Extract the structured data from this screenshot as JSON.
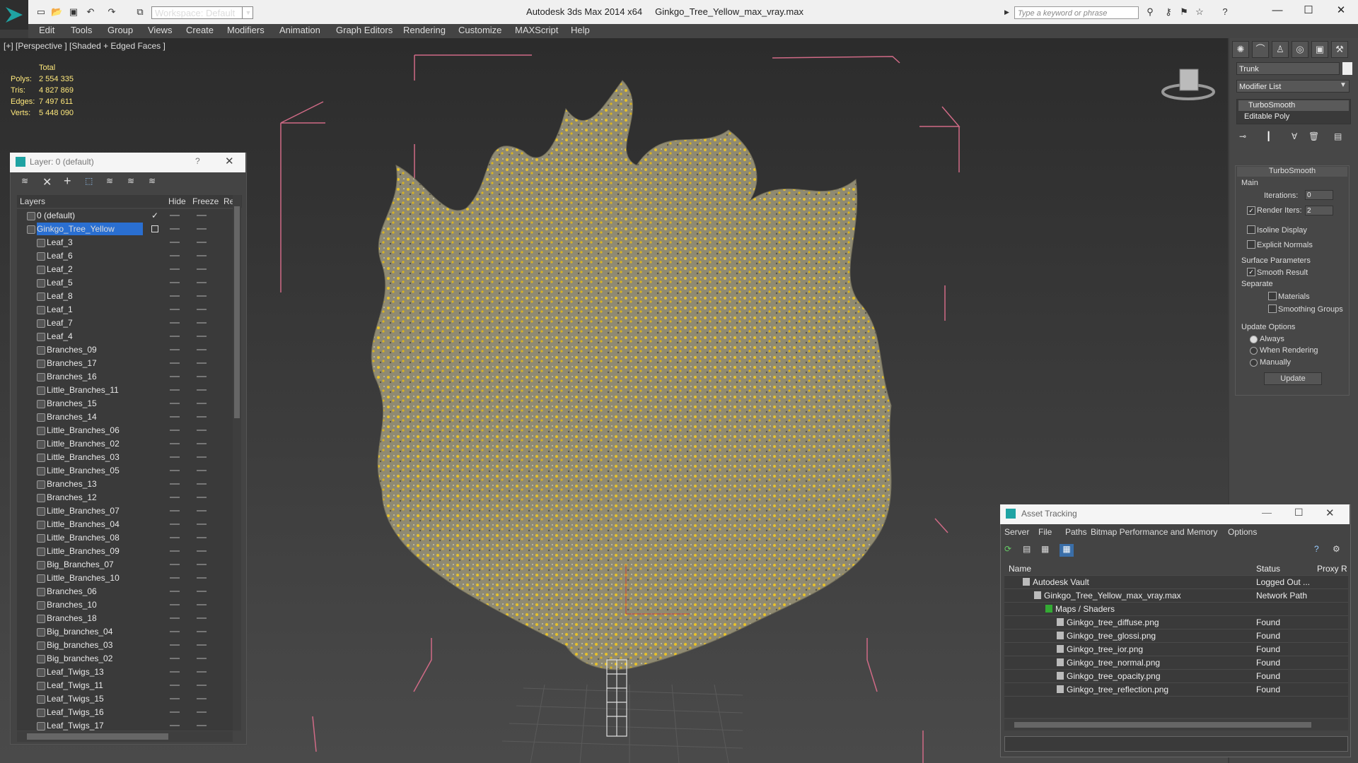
{
  "app": {
    "title": "Autodesk 3ds Max  2014 x64",
    "file": "Ginkgo_Tree_Yellow_max_vray.max",
    "workspace": "Workspace: Default",
    "search_placeholder": "Type a keyword or phrase"
  },
  "menu": [
    "Edit",
    "Tools",
    "Group",
    "Views",
    "Create",
    "Modifiers",
    "Animation",
    "Graph Editors",
    "Rendering",
    "Customize",
    "MAXScript",
    "Help"
  ],
  "viewport": {
    "label": "[+] [Perspective ] [Shaded + Edged Faces ]",
    "stats": {
      "header": "Total",
      "rows": [
        {
          "label": "Polys:",
          "value": "2 554 335"
        },
        {
          "label": "Tris:",
          "value": "4 827 869"
        },
        {
          "label": "Edges:",
          "value": "7 497 611"
        },
        {
          "label": "Verts:",
          "value": "5 448 090"
        }
      ]
    }
  },
  "layer_panel": {
    "title": "Layer: 0 (default)",
    "help": "?",
    "columns": {
      "layers": "Layers",
      "hide": "Hide",
      "freeze": "Freeze",
      "render": "Re"
    },
    "rows": [
      "0 (default)",
      "Ginkgo_Tree_Yellow",
      "Leaf_3",
      "Leaf_6",
      "Leaf_2",
      "Leaf_5",
      "Leaf_8",
      "Leaf_1",
      "Leaf_7",
      "Leaf_4",
      "Branches_09",
      "Branches_17",
      "Branches_16",
      "Little_Branches_11",
      "Branches_15",
      "Branches_14",
      "Little_Branches_06",
      "Little_Branches_02",
      "Little_Branches_03",
      "Little_Branches_05",
      "Branches_13",
      "Branches_12",
      "Little_Branches_07",
      "Little_Branches_04",
      "Little_Branches_08",
      "Little_Branches_09",
      "Big_Branches_07",
      "Little_Branches_10",
      "Branches_06",
      "Branches_10",
      "Branches_18",
      "Big_branches_04",
      "Big_branches_03",
      "Big_branches_02",
      "Leaf_Twigs_13",
      "Leaf_Twigs_11",
      "Leaf_Twigs_15",
      "Leaf_Twigs_16",
      "Leaf_Twigs_17"
    ]
  },
  "command_panel": {
    "object_name": "Trunk",
    "modifier_list": "Modifier List",
    "stack": [
      "TurboSmooth",
      "Editable Poly"
    ],
    "turbosmooth": {
      "title": "TurboSmooth",
      "main": "Main",
      "iterations_label": "Iterations:",
      "iterations": "0",
      "render_iters_label": "Render Iters:",
      "render_iters": "2",
      "isoline": "Isoline Display",
      "explicit": "Explicit Normals",
      "surface_params": "Surface Parameters",
      "smooth_result": "Smooth Result",
      "separate": "Separate",
      "materials": "Materials",
      "smoothing_groups": "Smoothing Groups",
      "update_options": "Update Options",
      "always": "Always",
      "when_rendering": "When Rendering",
      "manually": "Manually",
      "update": "Update"
    }
  },
  "asset_tracking": {
    "title": "Asset Tracking",
    "menu": [
      "Server",
      "File",
      "Paths",
      "Bitmap Performance and Memory",
      "Options"
    ],
    "columns": {
      "name": "Name",
      "status": "Status",
      "proxy": "Proxy R"
    },
    "rows": [
      {
        "name": "Autodesk Vault",
        "status": "Logged Out ...",
        "indent": 0
      },
      {
        "name": "Ginkgo_Tree_Yellow_max_vray.max",
        "status": "Network Path",
        "indent": 1
      },
      {
        "name": "Maps / Shaders",
        "status": "",
        "indent": 2
      },
      {
        "name": "Ginkgo_tree_diffuse.png",
        "status": "Found",
        "indent": 3
      },
      {
        "name": "Ginkgo_tree_glossi.png",
        "status": "Found",
        "indent": 3
      },
      {
        "name": "Ginkgo_tree_ior.png",
        "status": "Found",
        "indent": 3
      },
      {
        "name": "Ginkgo_tree_normal.png",
        "status": "Found",
        "indent": 3
      },
      {
        "name": "Ginkgo_tree_opacity.png",
        "status": "Found",
        "indent": 3
      },
      {
        "name": "Ginkgo_tree_reflection.png",
        "status": "Found",
        "indent": 3
      }
    ]
  }
}
